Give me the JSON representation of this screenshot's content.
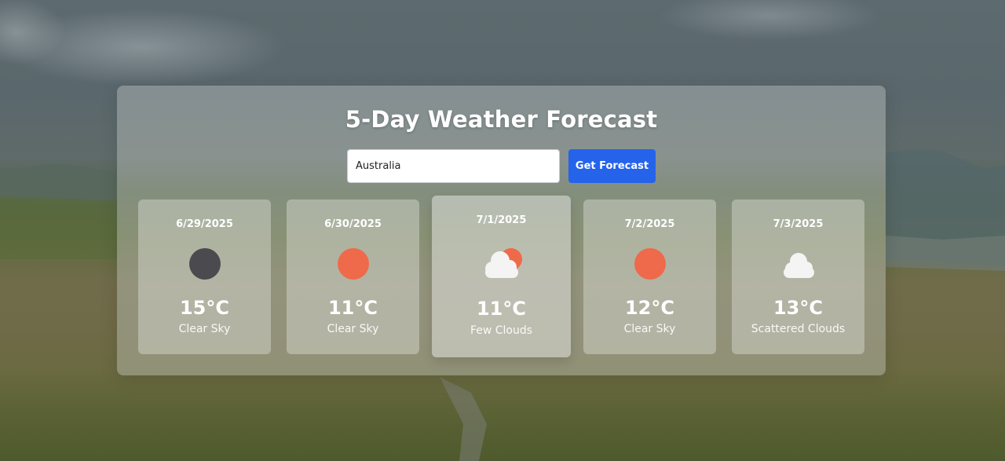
{
  "header": {
    "title": "5-Day Weather Forecast"
  },
  "search": {
    "value": "Australia",
    "button_label": "Get Forecast"
  },
  "colors": {
    "button": "#2563eb",
    "sun": "#ee6a4a",
    "dark_sun": "#4a4a4f",
    "cloud": "#f4f4f4"
  },
  "forecast": [
    {
      "date": "6/29/2025",
      "temp": "15°C",
      "description": "Clear Sky",
      "icon": "dark-sun-icon"
    },
    {
      "date": "6/30/2025",
      "temp": "11°C",
      "description": "Clear Sky",
      "icon": "sun-icon"
    },
    {
      "date": "7/1/2025",
      "temp": "11°C",
      "description": "Few Clouds",
      "icon": "sun-behind-cloud-icon"
    },
    {
      "date": "7/2/2025",
      "temp": "12°C",
      "description": "Clear Sky",
      "icon": "sun-icon"
    },
    {
      "date": "7/3/2025",
      "temp": "13°C",
      "description": "Scattered Clouds",
      "icon": "cloud-icon"
    }
  ]
}
